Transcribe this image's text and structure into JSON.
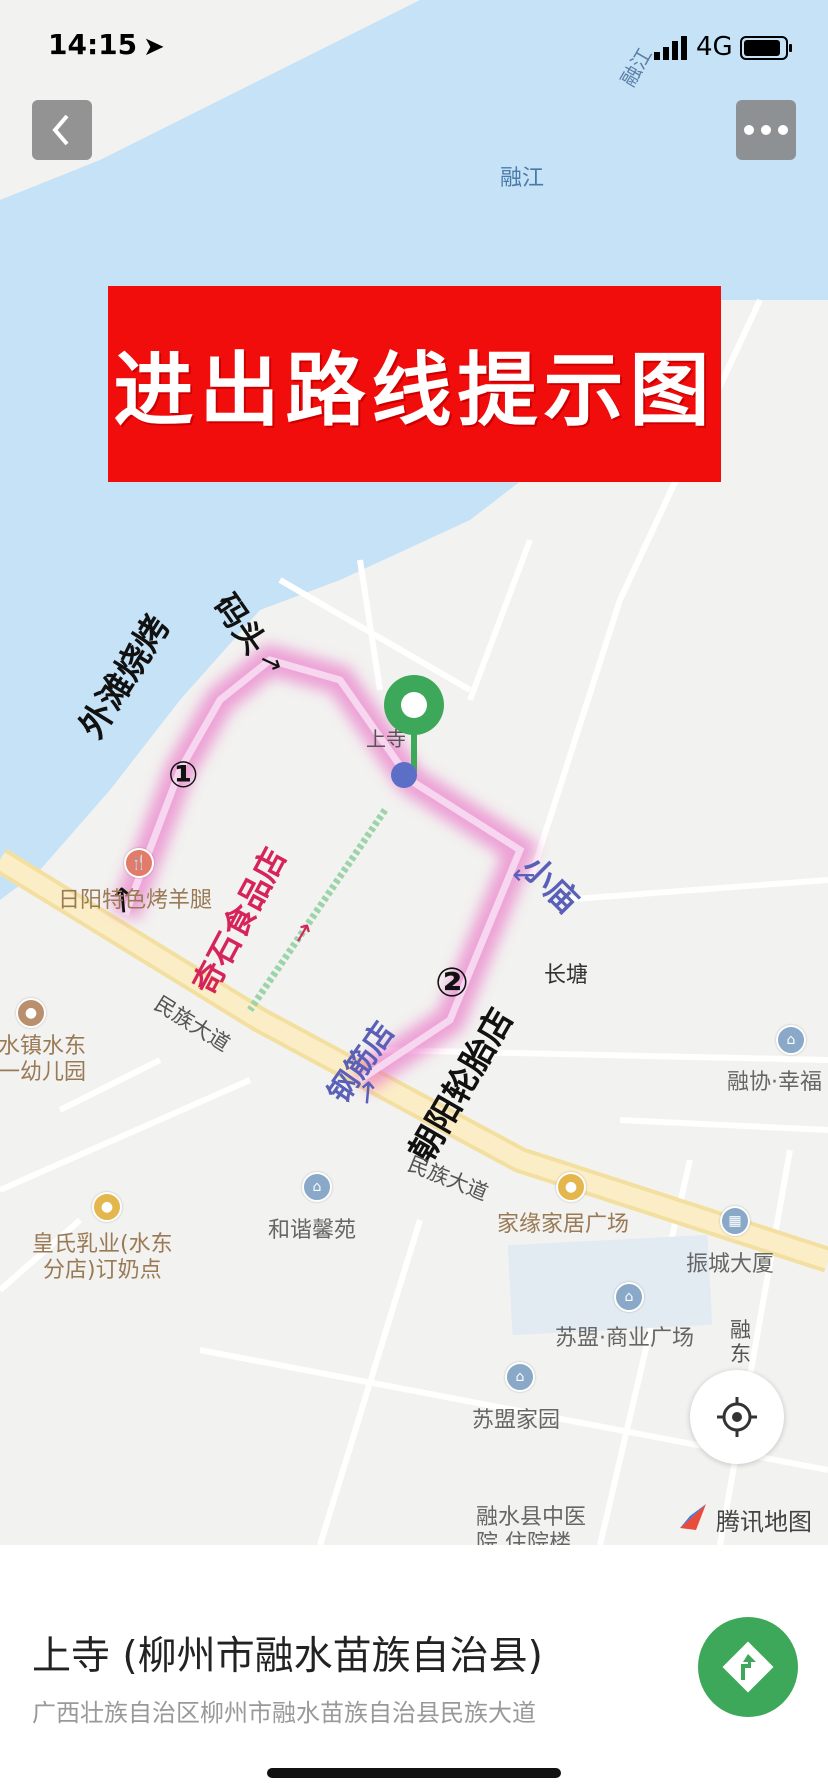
{
  "status_bar": {
    "time": "14:15",
    "network": "4G"
  },
  "map": {
    "banner": "进出路线提示图",
    "river_label": "融江",
    "river_label_small": "融江",
    "center_label": "上寺",
    "road_labels": [
      "民族大道",
      "民族大道",
      "融东"
    ],
    "route_labels": {
      "waitan": "外滩烧烤",
      "matou": "码头",
      "qishi": "奇石食品店",
      "xiaomiao": "小庙",
      "gangjin": "钢筋店",
      "chaoyang": "朝阳轮胎店",
      "circle1": "①",
      "circle2": "②"
    },
    "pois": {
      "riyang": "日阳特色烤羊腿",
      "changtang": "长塘",
      "kindergarten_1": "水镇水东",
      "kindergarten_2": "一幼儿园",
      "rongxie": "融协·幸福",
      "hexie": "和谐馨苑",
      "jiayuan": "家缘家居广场",
      "huangshi_1": "皇氏乳业(水东",
      "huangshi_2": "分店)订奶点",
      "zhencheng": "振城大厦",
      "sumeng_plaza": "苏盟·商业广场",
      "sumeng_home": "苏盟家园",
      "hospital_1": "融水县中医",
      "hospital_2": "院 住院楼"
    },
    "map_brand": "腾讯地图"
  },
  "sheet": {
    "title": "上寺 (柳州市融水苗族自治县)",
    "address": "广西壮族自治区柳州市融水苗族自治县民族大道"
  },
  "colors": {
    "river": "#c6e2f7",
    "land": "#f2f2f0",
    "banner": "#f20d0d",
    "nav": "#3ea85a",
    "route_glow": "#e85fc0",
    "pin": "#3ea85a"
  },
  "icons": [
    "back-icon",
    "more-icon",
    "location-arrow-icon",
    "signal-icon",
    "battery-icon",
    "locate-icon",
    "navigate-icon",
    "map-pin-icon",
    "restaurant-icon",
    "compass-icon"
  ]
}
